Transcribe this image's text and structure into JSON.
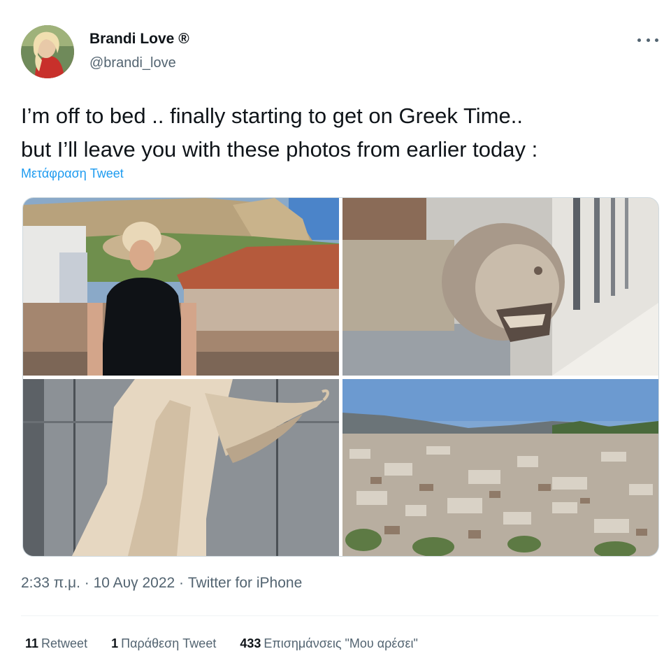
{
  "author": {
    "name": "Brandi Love ®",
    "handle": "@brandi_love"
  },
  "tweet": {
    "text_line1": "I’m off to bed .. finally starting to get on Greek Time..",
    "text_line2": "but I’ll leave you with these photos from earlier today :",
    "translate_label": "Μετάφραση Tweet",
    "meta": "2:33 π.μ. · 10 Αυγ 2022 · Twitter for iPhone"
  },
  "stats": {
    "retweets_count": "11",
    "retweets_label": "Retweet",
    "quotes_count": "1",
    "quotes_label": "Παράθεση Tweet",
    "likes_count": "433",
    "likes_label": "Επισημάνσεις \"Μου αρέσει\""
  },
  "icons": {
    "more": "more-horizontal-icon"
  },
  "colors": {
    "text_primary": "#0f1419",
    "text_secondary": "#536471",
    "link": "#1d9bf0",
    "border": "#cfd9de"
  }
}
